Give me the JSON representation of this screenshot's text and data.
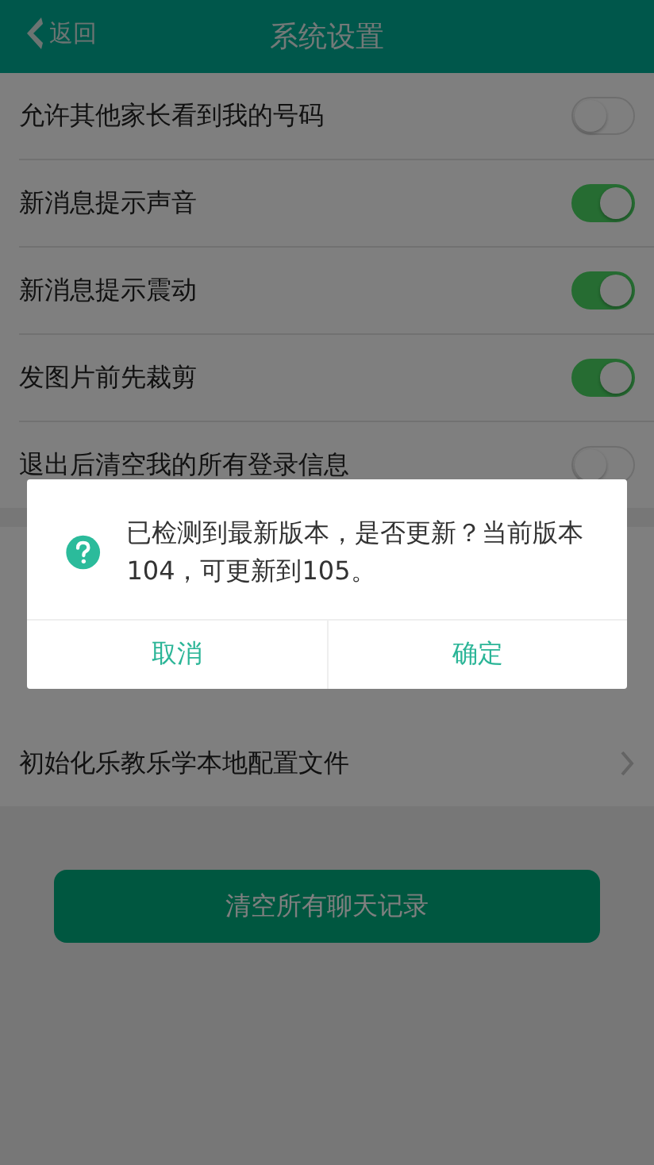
{
  "header": {
    "back": "返回",
    "title": "系统设置"
  },
  "settings": [
    {
      "label": "允许其他家长看到我的号码",
      "on": false
    },
    {
      "label": "新消息提示声音",
      "on": true
    },
    {
      "label": "新消息提示震动",
      "on": true
    },
    {
      "label": "发图片前先裁剪",
      "on": true
    },
    {
      "label": "退出后清空我的所有登录信息",
      "on": false
    }
  ],
  "links": [
    {
      "label": "初始化乐教乐学本地配置文件"
    }
  ],
  "clear_button": "清空所有聊天记录",
  "dialog": {
    "message": "已检测到最新版本，是否更新？当前版本104，可更新到105。",
    "buttons": [
      "取消",
      "确定"
    ]
  }
}
